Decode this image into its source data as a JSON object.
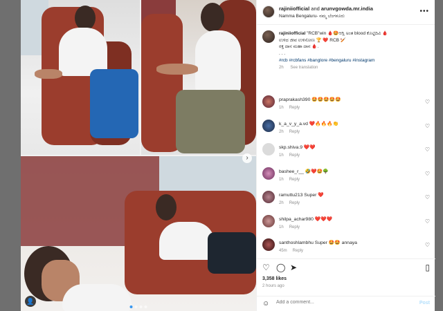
{
  "header": {
    "user1": "rajiniiofficial",
    "joiner": " and ",
    "user2": "arunvgowda.mr.india",
    "location": "Namma Bengaluru- ನಮ್ಮ ಬೆಂಗಳೂರು"
  },
  "caption": {
    "username": "rajiniiofficial",
    "line1": "\"RCB\"win 🩸🤩ಆಗ್ಲಿ ಅಂತ blood ಕೊಟ್ಟಿದಿವಿ 🩸",
    "line2": "ಉಳಿದ ಜೀವ ಉಳಿಸೋಣ 🏆 ❤️ RCB 🏏",
    "line3": "ರಕ್ತ ದಾನ ಮಹಾ ದಾನ 🩸.",
    "dots": ". . .",
    "hashtags": "#rcb #rcbfans #banglore #bengaluru #instagram",
    "age": "2h",
    "translate": "See translation"
  },
  "comments": [
    {
      "user": "praprakash390",
      "text": "🤩🤩🤩🤩🤩",
      "age": "1h",
      "reply": "Reply"
    },
    {
      "user": "k_a_v_y_a.vd",
      "text": "❤️🔥🔥🔥👏",
      "age": "2h",
      "reply": "Reply"
    },
    {
      "user": "skp.shiva.9",
      "text": "❤️❤️",
      "age": "1h",
      "reply": "Reply"
    },
    {
      "user": "bashee_r__",
      "text": "🤣❤️🤩🌳",
      "age": "1h",
      "reply": "Reply"
    },
    {
      "user": "ramuttu213",
      "text": "Super ❤️",
      "age": "2h",
      "reply": "Reply"
    },
    {
      "user": "shilpa_achar980",
      "text": "❤️❤️❤️",
      "age": "1h",
      "reply": "Reply"
    },
    {
      "user": "santhoshlambhu",
      "text": "Super 🤩🤩 annaya",
      "age": "45m",
      "reply": "Reply"
    }
  ],
  "actions": {
    "likes": "3,358 likes",
    "posted": "2 hours ago"
  },
  "add_comment": {
    "placeholder": "Add a comment...",
    "post": "Post"
  },
  "icons": {
    "like": "heart-icon",
    "comment": "comment-icon",
    "share": "share-icon",
    "save": "bookmark-icon",
    "more": "more-icon",
    "emoji": "emoji-icon",
    "next": "chevron-right-icon",
    "tag": "user-tag-icon"
  },
  "colors": {
    "link": "#00376b",
    "post_disabled": "#b2dffc",
    "muted": "#8e8e8e",
    "chair": "#9b3d2d"
  }
}
